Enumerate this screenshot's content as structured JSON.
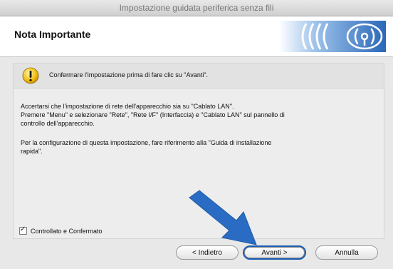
{
  "window": {
    "title": "Impostazione guidata periferica senza fili"
  },
  "header": {
    "title": "Nota Importante",
    "logo_icon": "wireless-signal-icon"
  },
  "notice": {
    "icon": "warning-icon",
    "text": "Confermare l'impostazione prima di fare clic su \"Avanti\"."
  },
  "body": {
    "paragraph1": "Accertarsi che l'impostazione di rete dell'apparecchio sia su  \"Cablato LAN\".\nPremere \"Menu\" e selezionare \"Rete\", \"Rete I/F\" (Interfaccia) e \"Cablato LAN\" sul pannello di\ncontrollo dell'apparecchio.",
    "paragraph2": "Per la configurazione di questa impostazione, fare riferimento alla \"Guida di installazione\nrapida\"."
  },
  "checkbox": {
    "label": "Controllato e Confermato",
    "checked": true
  },
  "buttons": {
    "back": "< Indietro",
    "next": "Avanti >",
    "cancel": "Annulla"
  },
  "colors": {
    "accent": "#1a5fb4",
    "arrow": "#2a6cc4"
  }
}
